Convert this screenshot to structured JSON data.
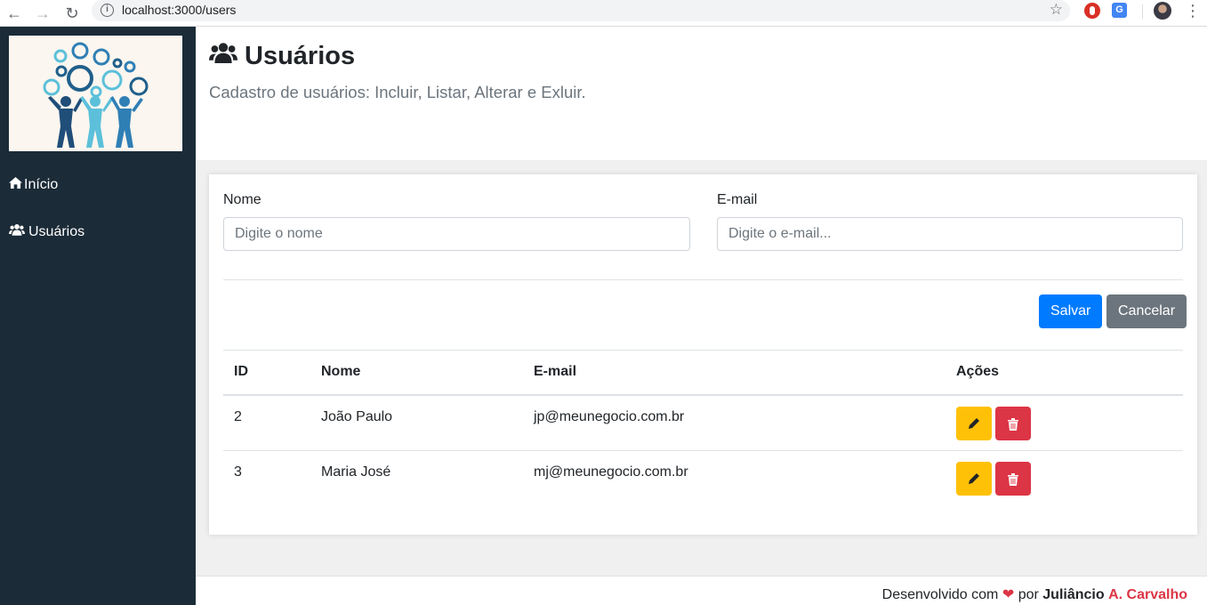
{
  "browser": {
    "url": "localhost:3000/users"
  },
  "sidebar": {
    "items": [
      {
        "label": "Início",
        "icon": "home-icon"
      },
      {
        "label": "Usuários",
        "icon": "users-icon"
      }
    ]
  },
  "header": {
    "title": "Usuários",
    "subtitle": "Cadastro de usuários: Incluir, Listar, Alterar e Exluir."
  },
  "form": {
    "name_label": "Nome",
    "name_placeholder": "Digite o nome",
    "email_label": "E-mail",
    "email_placeholder": "Digite o e-mail...",
    "save_label": "Salvar",
    "cancel_label": "Cancelar"
  },
  "table": {
    "headers": [
      "ID",
      "Nome",
      "E-mail",
      "Ações"
    ],
    "rows": [
      {
        "id": "2",
        "nome": "João Paulo",
        "email": "jp@meunegocio.com.br"
      },
      {
        "id": "3",
        "nome": "Maria José",
        "email": "mj@meunegocio.com.br"
      }
    ]
  },
  "footer": {
    "prefix": "Desenvolvido com",
    "middle": "por",
    "author_first": "Juliâncio",
    "author_last": "A. Carvalho"
  },
  "colors": {
    "sidebar_bg": "#1b2b37",
    "primary": "#007bff",
    "secondary": "#6c757d",
    "warning": "#ffc107",
    "danger": "#dc3545"
  }
}
